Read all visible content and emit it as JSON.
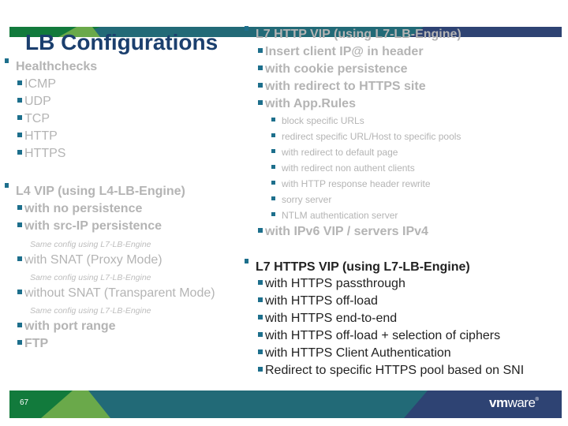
{
  "slide": {
    "title": "LB Configurations",
    "page_number": "67",
    "logo": {
      "vm": "vm",
      "ware": "ware",
      "reg": "®"
    },
    "colors": {
      "title": "#1b3f6e",
      "bullet": "#1d6f8c",
      "greyed_text": "#b4b4b4",
      "active_text": "#222222",
      "banner_dark_green": "#127a3c",
      "banner_light_green": "#6aa94a",
      "banner_teal": "#226a77",
      "banner_navy": "#2e4373"
    }
  },
  "left_column": {
    "healthchecks": {
      "label": "Healthchecks",
      "items": [
        "ICMP",
        "UDP",
        "TCP",
        "HTTP",
        "HTTPS"
      ]
    },
    "l4_vip": {
      "label": "L4 VIP (using L4-LB-Engine)",
      "items": [
        {
          "label": "with no persistence"
        },
        {
          "label": "with src-IP persistence",
          "note": "Same config using L7-LB-Engine"
        },
        {
          "label": "with SNAT (Proxy Mode)",
          "note": "Same config using L7-LB-Engine"
        },
        {
          "label": "without SNAT (Transparent Mode)",
          "note": "Same config using L7-LB-Engine"
        },
        {
          "label": "with port range"
        },
        {
          "label": "FTP"
        }
      ]
    }
  },
  "right_column": {
    "l7_http_vip": {
      "label": "L7 HTTP VIP (using L7-LB-Engine)",
      "items": [
        "Insert client IP@ in header",
        "with cookie persistence",
        "with redirect to HTTPS site",
        "with App.Rules"
      ],
      "apprules": [
        "block specific URLs",
        "redirect specific URL/Host to specific pools",
        "with redirect to default page",
        "with redirect non authent clients",
        "with HTTP response header rewrite",
        "sorry server",
        "NTLM authentication server"
      ],
      "ipv6": "with IPv6 VIP / servers IPv4"
    },
    "l7_https_vip": {
      "label": "L7 HTTPS VIP (using L7-LB-Engine)",
      "items": [
        "with HTTPS passthrough",
        "with HTTPS off-load",
        "with HTTPS end-to-end",
        "with HTTPS off-load + selection of ciphers",
        "with HTTPS Client Authentication",
        "Redirect to specific HTTPS pool based on SNI"
      ]
    }
  }
}
